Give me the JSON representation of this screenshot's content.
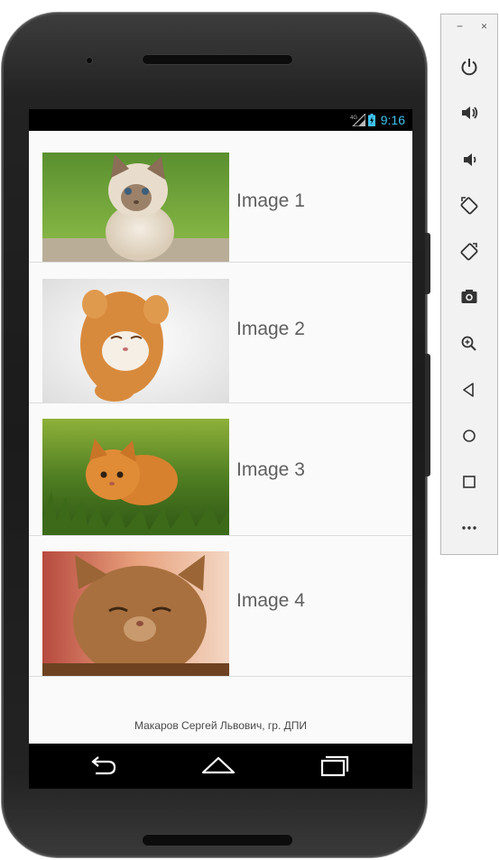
{
  "status_bar": {
    "network": "4G",
    "time": "9:16"
  },
  "list": {
    "items": [
      {
        "label": "Image 1",
        "image": "siamese-kitten-on-grass"
      },
      {
        "label": "Image 2",
        "image": "ginger-kitten-on-back"
      },
      {
        "label": "Image 3",
        "image": "fluffy-ginger-kitten-in-grass"
      },
      {
        "label": "Image 4",
        "image": "tabby-cat-squinting"
      }
    ]
  },
  "footer": {
    "text": "Макаров Сергей Львович, гр. ДПИ"
  },
  "nav": {
    "back": "back-icon",
    "home": "home-icon",
    "recents": "recents-icon"
  },
  "emulator_toolbar": {
    "minimize": "−",
    "close": "×",
    "buttons": [
      "power-icon",
      "volume-up-icon",
      "volume-down-icon",
      "rotate-left-icon",
      "rotate-right-icon",
      "camera-icon",
      "zoom-icon",
      "back-icon",
      "home-icon",
      "overview-icon",
      "more-icon"
    ]
  },
  "colors": {
    "clock": "#3fc3ef",
    "label": "#5f5f5f",
    "screen_bg": "#fafafa"
  }
}
